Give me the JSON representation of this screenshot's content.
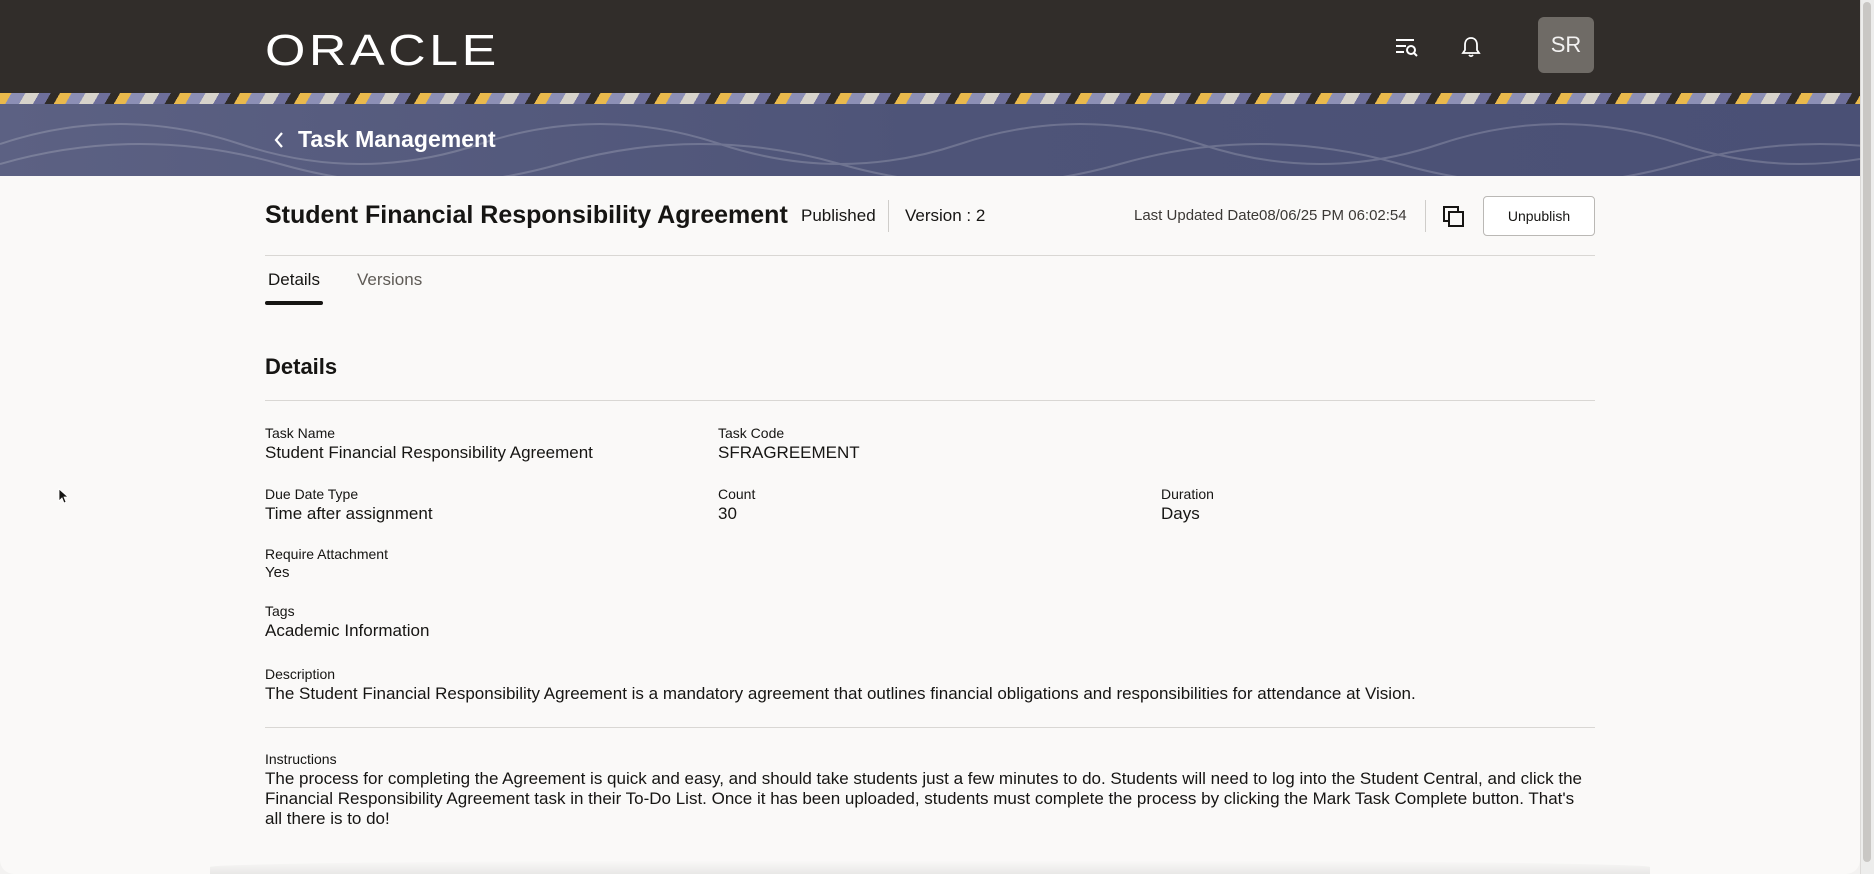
{
  "header": {
    "logo_text": "ORACLE",
    "icons": [
      "search-list-icon",
      "bell-icon"
    ],
    "avatar_initials": "SR"
  },
  "banner": {
    "title": "Task Management"
  },
  "task": {
    "title": "Student Financial Responsibility Agreement",
    "status": "Published",
    "version": "Version : 2",
    "last_updated_label": "Last Updated Date",
    "last_updated_value": "08/06/25 PM 06:02:54",
    "unpublish_label": "Unpublish"
  },
  "tabs": [
    {
      "label": "Details",
      "active": true
    },
    {
      "label": "Versions",
      "active": false
    }
  ],
  "details": {
    "section_title": "Details",
    "task_name_label": "Task Name",
    "task_name_value": "Student Financial Responsibility Agreement",
    "task_code_label": "Task Code",
    "task_code_value": "SFRAGREEMENT",
    "due_date_type_label": "Due Date Type",
    "due_date_type_value": "Time after assignment",
    "count_label": "Count",
    "count_value": "30",
    "duration_label": "Duration",
    "duration_value": "Days",
    "require_attachment_label": "Require Attachment",
    "require_attachment_value": "Yes",
    "tags_label": "Tags",
    "tags_value": "Academic Information",
    "description_label": "Description",
    "description_value": "The Student Financial Responsibility Agreement is a mandatory agreement that outlines financial obligations and responsibilities for attendance at Vision.",
    "instructions_label": "Instructions",
    "instructions_value": "The process for completing the Agreement is quick and easy, and should take students just a few minutes to do. Students will need to log into the Student Central, and click the Financial Responsibility Agreement task in their To-Do List. Once it has been uploaded, students must complete the process by clicking the Mark Task Complete button. That's all there is to do!"
  },
  "colors": {
    "header_bg": "#312d2a",
    "banner_bg": "#4e5478",
    "page_bg": "#faf9f8"
  }
}
